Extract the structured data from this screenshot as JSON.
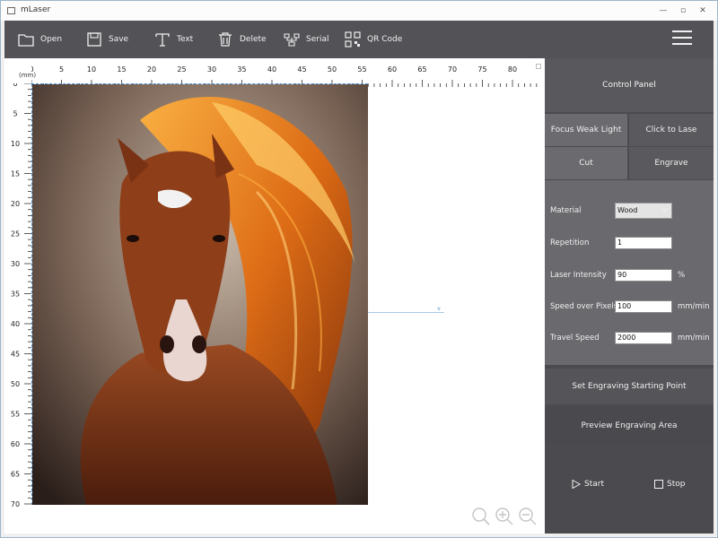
{
  "window": {
    "title": "mLaser"
  },
  "toolbar": {
    "open": "Open",
    "save": "Save",
    "text": "Text",
    "delete": "Delete",
    "serial": "Serial",
    "qr": "QR Code"
  },
  "canvas": {
    "unit": "(mm)",
    "ruler_top": [
      "0",
      "5",
      "10",
      "15",
      "20",
      "25",
      "30",
      "35",
      "40",
      "45",
      "50",
      "55",
      "60",
      "65",
      "70",
      "75",
      "80"
    ],
    "ruler_left": [
      "0",
      "5",
      "10",
      "15",
      "20",
      "25",
      "30",
      "35",
      "40",
      "45",
      "50",
      "55",
      "60",
      "65",
      "70"
    ]
  },
  "panel": {
    "title": "Control Panel",
    "mode_focus": "Focus Weak Light",
    "mode_laser": "Click to Lase",
    "mode_cut": "Cut",
    "mode_engrave": "Engrave",
    "params": {
      "material_label": "Material",
      "material_value": "Wood",
      "repetition_label": "Repetition",
      "repetition_value": "1",
      "intensity_label": "Laser Intensity",
      "intensity_value": "90",
      "intensity_unit": "%",
      "speed_label": "Speed over Pixels",
      "speed_value": "100",
      "speed_unit": "mm/min",
      "travel_label": "Travel Speed",
      "travel_value": "2000",
      "travel_unit": "mm/min"
    },
    "set_start": "Set Engraving Starting Point",
    "preview": "Preview Engraving Area",
    "start": "Start",
    "stop": "Stop"
  },
  "colors": {
    "toolbar": "#535357",
    "panel": "#4b4b4f",
    "accent_guide": "#4a8fd0"
  }
}
